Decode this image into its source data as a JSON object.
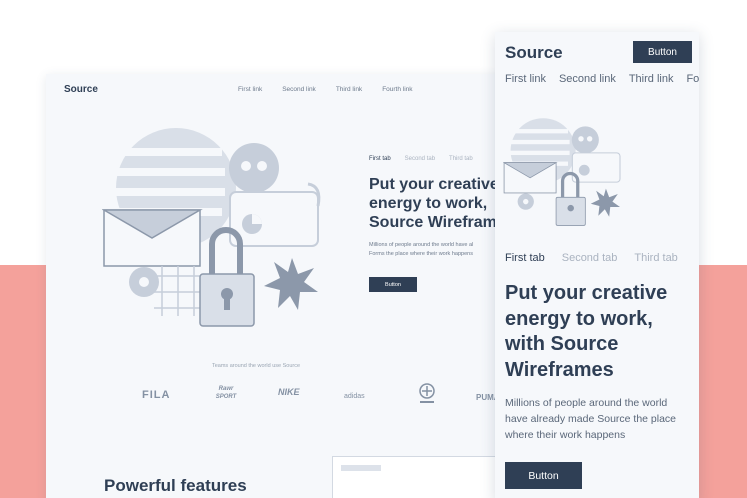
{
  "colors": {
    "accent": "#2f3f55",
    "band": "#f4a19b",
    "canvas": "#f6f8fb",
    "illustration": "#c6ceda"
  },
  "desktop": {
    "brand": "Source",
    "nav": [
      "First link",
      "Second link",
      "Third link",
      "Fourth link"
    ],
    "tabs": [
      "First tab",
      "Second tab",
      "Third tab"
    ],
    "heading": "Put your creative\nenergy to work,\nSource Wirefram",
    "description": "Millions of people around the world have al\nForms the place where their work happens",
    "cta": "Button",
    "teams_caption": "Teams around the world use Source",
    "logos": [
      "FILA",
      "Rawr SPORT",
      "NIKE",
      "adidas",
      "emblem",
      "PUMA"
    ],
    "features_title": "Powerful features"
  },
  "mobile": {
    "brand": "Source",
    "top_button": "Button",
    "nav": [
      "First link",
      "Second link",
      "Third link",
      "Fo"
    ],
    "tabs": [
      "First tab",
      "Second tab",
      "Third tab"
    ],
    "heading": "Put your creative\nenergy to work,\nwith Source\nWireframes",
    "description": "Millions of people around the world\nhave already made Source the place\nwhere their work happens",
    "cta": "Button"
  }
}
